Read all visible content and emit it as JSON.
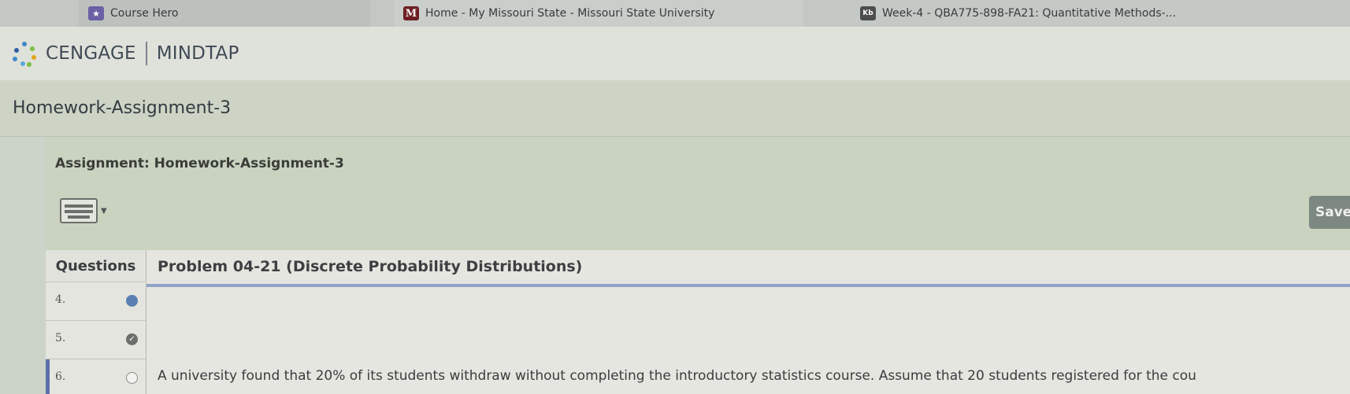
{
  "bookmarks": [
    {
      "label": "Course Hero",
      "icon": "course-hero-star-icon"
    },
    {
      "label": "Home - My Missouri State - Missouri State University",
      "icon": "missouri-m-icon"
    },
    {
      "label": "Week-4 - QBA775-898-FA21: Quantitative Methods-...",
      "icon": "kb-icon"
    }
  ],
  "header": {
    "brand_left": "CENGAGE",
    "brand_right": "MINDTAP"
  },
  "assignment_bar": {
    "title": "Homework-Assignment-3"
  },
  "panel": {
    "assignment_label": "Assignment: Homework-Assignment-3",
    "save_label": "Save"
  },
  "questions": {
    "header": "Questions",
    "items": [
      {
        "number": "4.",
        "status": "answered"
      },
      {
        "number": "5.",
        "status": "completed"
      },
      {
        "number": "6.",
        "status": "unanswered"
      }
    ]
  },
  "problem": {
    "title": "Problem 04-21 (Discrete Probability Distributions)",
    "text": "A university found that 20% of its students withdraw without completing the introductory statistics course. Assume that 20 students registered for the cou"
  },
  "colors": {
    "accent_blue": "#5b7fb0",
    "underline": "#8fa3c8",
    "save_bg": "#7e8882"
  }
}
